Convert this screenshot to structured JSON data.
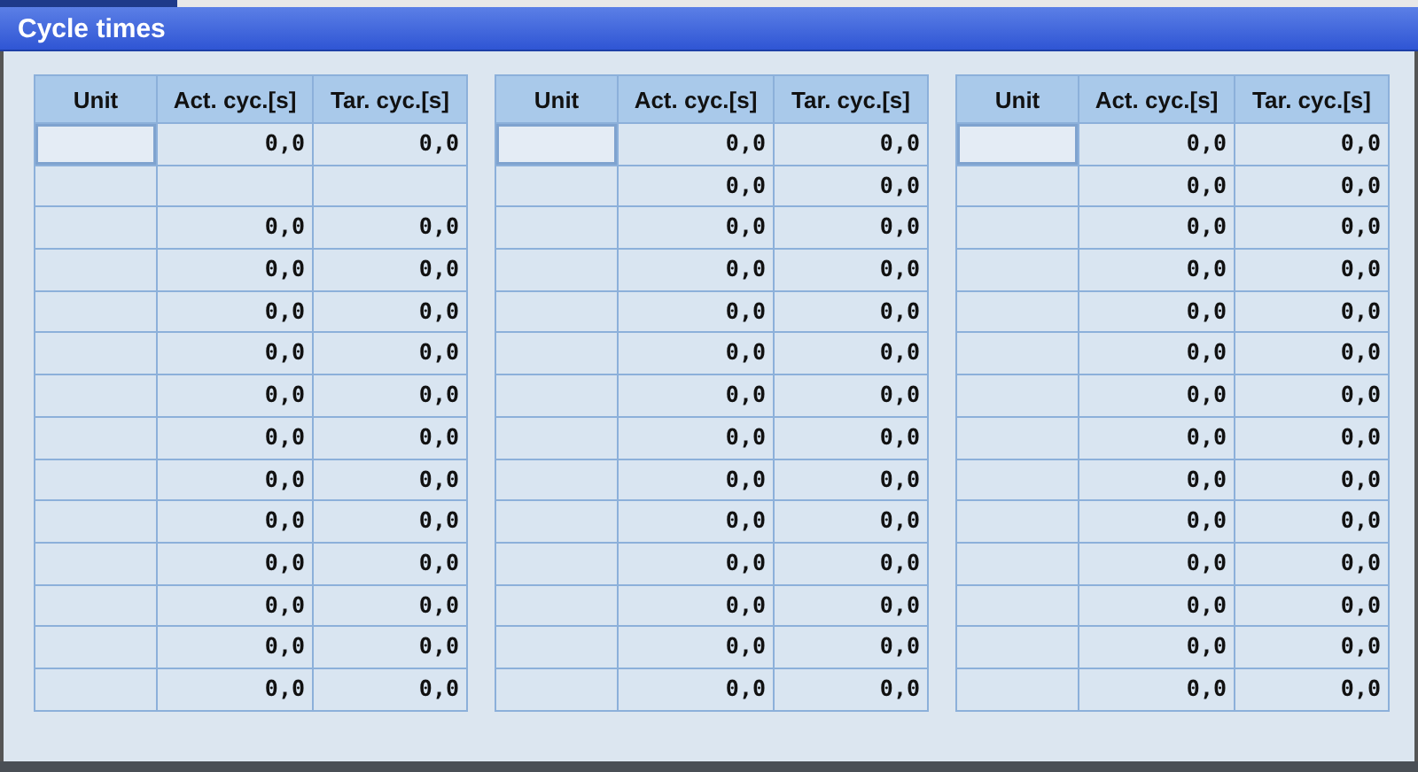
{
  "window": {
    "title": "Cycle times"
  },
  "tables": [
    {
      "columns": [
        "Unit",
        "Act. cyc.[s]",
        "Tar. cyc.[s]"
      ],
      "rows": [
        {
          "selected": true,
          "act": "0,0",
          "tar": "0,0"
        },
        {
          "selected": false
        },
        {
          "selected": false,
          "act": "0,0",
          "tar": "0,0"
        },
        {
          "selected": false,
          "act": "0,0",
          "tar": "0,0"
        },
        {
          "selected": false,
          "act": "0,0",
          "tar": "0,0"
        },
        {
          "selected": false,
          "act": "0,0",
          "tar": "0,0"
        },
        {
          "selected": false,
          "act": "0,0",
          "tar": "0,0"
        },
        {
          "selected": false,
          "act": "0,0",
          "tar": "0,0"
        },
        {
          "selected": false,
          "act": "0,0",
          "tar": "0,0"
        },
        {
          "selected": false,
          "act": "0,0",
          "tar": "0,0"
        },
        {
          "selected": false,
          "act": "0,0",
          "tar": "0,0"
        },
        {
          "selected": false,
          "act": "0,0",
          "tar": "0,0"
        },
        {
          "selected": false,
          "act": "0,0",
          "tar": "0,0"
        },
        {
          "selected": false,
          "act": "0,0",
          "tar": "0,0"
        }
      ]
    },
    {
      "columns": [
        "Unit",
        "Act. cyc.[s]",
        "Tar. cyc.[s]"
      ],
      "rows": [
        {
          "selected": true,
          "act": "0,0",
          "tar": "0,0"
        },
        {
          "selected": false,
          "act": "0,0",
          "tar": "0,0"
        },
        {
          "selected": false,
          "act": "0,0",
          "tar": "0,0"
        },
        {
          "selected": false,
          "act": "0,0",
          "tar": "0,0"
        },
        {
          "selected": false,
          "act": "0,0",
          "tar": "0,0"
        },
        {
          "selected": false,
          "act": "0,0",
          "tar": "0,0"
        },
        {
          "selected": false,
          "act": "0,0",
          "tar": "0,0"
        },
        {
          "selected": false,
          "act": "0,0",
          "tar": "0,0"
        },
        {
          "selected": false,
          "act": "0,0",
          "tar": "0,0"
        },
        {
          "selected": false,
          "act": "0,0",
          "tar": "0,0"
        },
        {
          "selected": false,
          "act": "0,0",
          "tar": "0,0"
        },
        {
          "selected": false,
          "act": "0,0",
          "tar": "0,0"
        },
        {
          "selected": false,
          "act": "0,0",
          "tar": "0,0"
        },
        {
          "selected": false,
          "act": "0,0",
          "tar": "0,0"
        }
      ]
    },
    {
      "columns": [
        "Unit",
        "Act. cyc.[s]",
        "Tar. cyc.[s]"
      ],
      "rows": [
        {
          "selected": true,
          "act": "0,0",
          "tar": "0,0"
        },
        {
          "selected": false,
          "act": "0,0",
          "tar": "0,0"
        },
        {
          "selected": false,
          "act": "0,0",
          "tar": "0,0"
        },
        {
          "selected": false,
          "act": "0,0",
          "tar": "0,0"
        },
        {
          "selected": false,
          "act": "0,0",
          "tar": "0,0"
        },
        {
          "selected": false,
          "act": "0,0",
          "tar": "0,0"
        },
        {
          "selected": false,
          "act": "0,0",
          "tar": "0,0"
        },
        {
          "selected": false,
          "act": "0,0",
          "tar": "0,0"
        },
        {
          "selected": false,
          "act": "0,0",
          "tar": "0,0"
        },
        {
          "selected": false,
          "act": "0,0",
          "tar": "0,0"
        },
        {
          "selected": false,
          "act": "0,0",
          "tar": "0,0"
        },
        {
          "selected": false,
          "act": "0,0",
          "tar": "0,0"
        },
        {
          "selected": false,
          "act": "0,0",
          "tar": "0,0"
        },
        {
          "selected": false,
          "act": "0,0",
          "tar": "0,0"
        }
      ]
    }
  ]
}
